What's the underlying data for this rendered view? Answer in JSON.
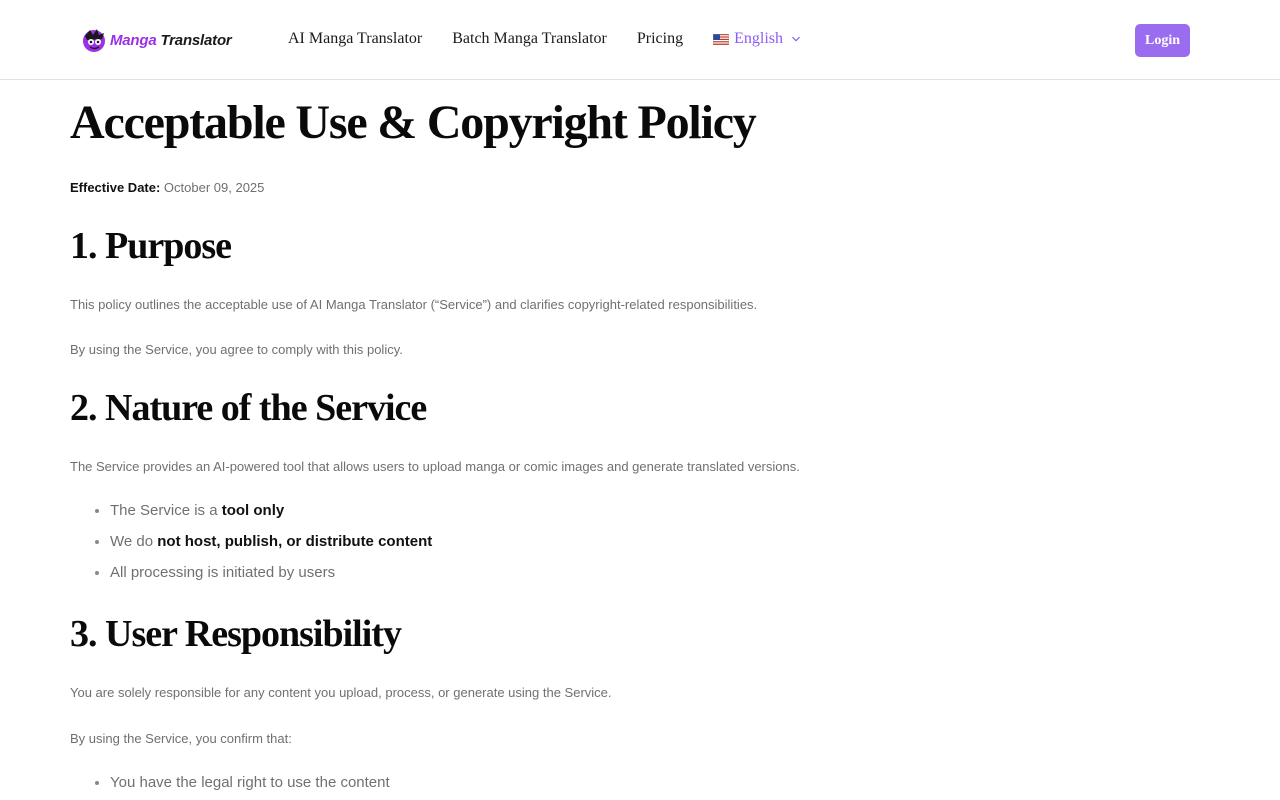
{
  "header": {
    "logo": {
      "accent": "Manga",
      "dark": " Translator",
      "icon": "manga-character-logo-icon"
    },
    "nav": {
      "ai_translator": "AI Manga Translator",
      "batch_translator": "Batch Manga Translator",
      "pricing": "Pricing",
      "language": "English",
      "language_flag_icon": "us-flag-icon",
      "language_chevron_icon": "chevron-down-icon"
    },
    "login_label": "Login"
  },
  "colors": {
    "brand_purple": "#9a6cf0",
    "logo_accent": "#9b30e8",
    "language_link": "#8b5cf6",
    "body_text": "#707070"
  },
  "main": {
    "title": "Acceptable Use & Copyright Policy",
    "effective_label": "Effective Date:",
    "effective_date": " October 09, 2025",
    "sections": [
      {
        "heading": "1. Purpose",
        "paragraphs": [
          "This policy outlines the acceptable use of AI Manga Translator (“Service”) and clarifies copyright-related responsibilities.",
          "By using the Service, you agree to comply with this policy."
        ]
      },
      {
        "heading": "2. Nature of the Service",
        "paragraphs": [
          "The Service provides an AI-powered tool that allows users to upload manga or comic images and generate translated versions."
        ],
        "bullets": [
          {
            "text": "The Service is a ",
            "bold": "tool only"
          },
          {
            "text": "We do ",
            "bold": "not host, publish, or distribute content"
          },
          {
            "text": "All processing is initiated by users",
            "bold": ""
          }
        ]
      },
      {
        "heading": "3. User Responsibility",
        "paragraphs": [
          "You are solely responsible for any content you upload, process, or generate using the Service.",
          "By using the Service, you confirm that:"
        ],
        "bullets": [
          {
            "text": "You have the legal right to use the content",
            "bold": ""
          }
        ]
      }
    ]
  }
}
